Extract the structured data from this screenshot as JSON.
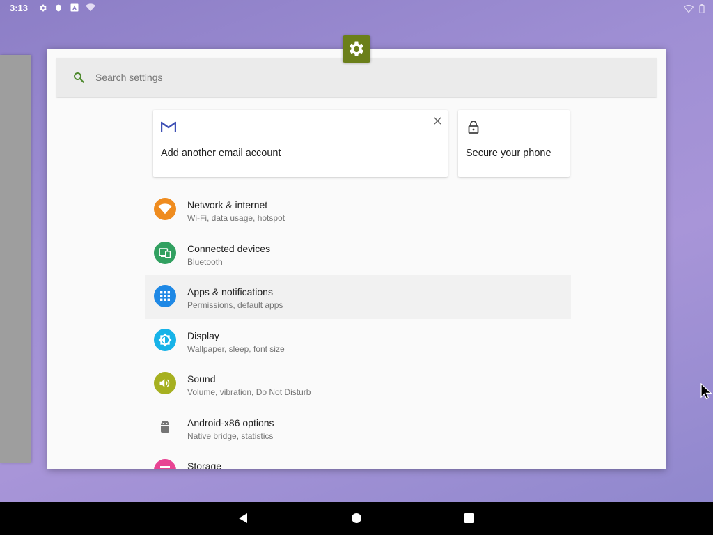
{
  "status_bar": {
    "time": "3:13",
    "left_icons": [
      "settings-gear-icon",
      "shield-icon",
      "a-icon",
      "wifi-off-icon"
    ],
    "right_icons": [
      "wifi-icon",
      "battery-icon"
    ]
  },
  "app": {
    "icon": "settings-gear-icon",
    "accent": "#6b7f1a"
  },
  "search": {
    "placeholder": "Search settings"
  },
  "suggestions": [
    {
      "label": "Add another email account",
      "icon": "gmail-icon",
      "dismissable": true
    },
    {
      "label": "Secure your phone",
      "icon": "lock-icon",
      "dismissable": false
    }
  ],
  "settings": [
    {
      "title": "Network & internet",
      "subtitle": "Wi‑Fi, data usage, hotspot",
      "icon": "wifi-icon",
      "color": "#ef8c1f"
    },
    {
      "title": "Connected devices",
      "subtitle": "Bluetooth",
      "icon": "devices-icon",
      "color": "#31a060"
    },
    {
      "title": "Apps & notifications",
      "subtitle": "Permissions, default apps",
      "icon": "apps-grid-icon",
      "color": "#1e88e5"
    },
    {
      "title": "Display",
      "subtitle": "Wallpaper, sleep, font size",
      "icon": "brightness-icon",
      "color": "#17b3e8"
    },
    {
      "title": "Sound",
      "subtitle": "Volume, vibration, Do Not Disturb",
      "icon": "volume-icon",
      "color": "#a6b020"
    },
    {
      "title": "Android-x86 options",
      "subtitle": "Native bridge, statistics",
      "icon": "android-icon",
      "color": "#757575"
    },
    {
      "title": "Storage",
      "subtitle": "",
      "icon": "storage-icon",
      "color": "#e84393"
    }
  ],
  "nav_bar": {
    "buttons": [
      "back-icon",
      "home-icon",
      "recents-icon"
    ]
  }
}
